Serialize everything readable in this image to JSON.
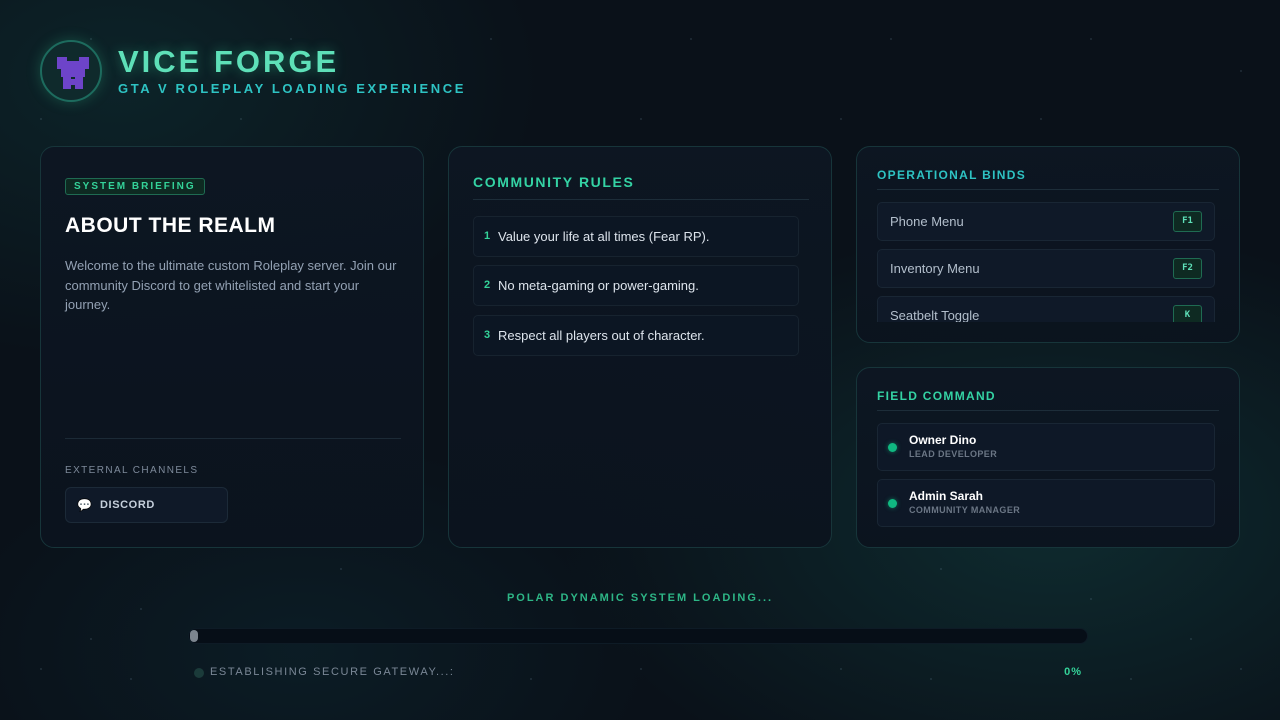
{
  "brand": {
    "title": "VICE FORGE",
    "subtitle": "GTA V ROLEPLAY LOADING EXPERIENCE",
    "logo_icon": "creeper-mask-icon"
  },
  "about": {
    "badge": "SYSTEM BRIEFING",
    "title": "ABOUT THE REALM",
    "text": "Welcome to the ultimate custom Roleplay server. Join our community Discord to get whitelisted and start your journey.",
    "channels_label": "EXTERNAL CHANNELS",
    "discord_icon": "chat-bubble-icon",
    "discord_label": "DISCORD"
  },
  "rules": {
    "title": "COMMUNITY RULES",
    "items": [
      {
        "num": "1",
        "text": "Value your life at all times (Fear RP)."
      },
      {
        "num": "2",
        "text": "No meta-gaming or power-gaming."
      },
      {
        "num": "3",
        "text": "Respect all players out of character."
      }
    ]
  },
  "binds": {
    "title": "OPERATIONAL BINDS",
    "items": [
      {
        "label": "Phone Menu",
        "key": "F1"
      },
      {
        "label": "Inventory Menu",
        "key": "F2"
      },
      {
        "label": "Seatbelt Toggle",
        "key": "K"
      }
    ]
  },
  "staff": {
    "title": "FIELD COMMAND",
    "members": [
      {
        "name": "Owner Dino",
        "role": "LEAD DEVELOPER"
      },
      {
        "name": "Admin Sarah",
        "role": "COMMUNITY MANAGER"
      }
    ]
  },
  "loading": {
    "label": "POLAR DYNAMIC SYSTEM LOADING...",
    "status": "ESTABLISHING SECURE GATEWAY...:",
    "percent": "0%",
    "progress": 0
  },
  "colors": {
    "accent": "#34d399",
    "accent_cyan": "#2ec3c3",
    "background": "#0a1119",
    "logo_purple": "#6d44c9"
  }
}
